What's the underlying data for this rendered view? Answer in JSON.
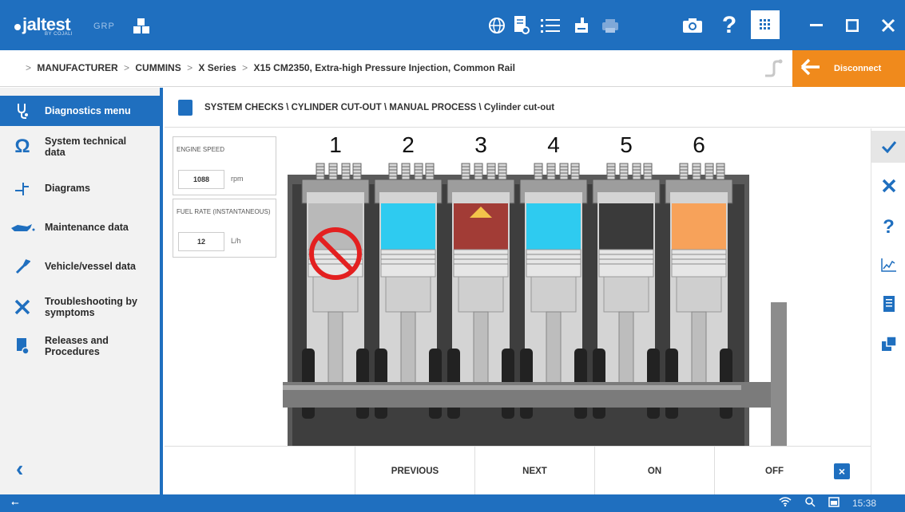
{
  "app": {
    "logo": "jaltest",
    "logo_sub": "BY COJALI",
    "grp": "GRP"
  },
  "toolbar": {
    "icons": [
      "globe-icon",
      "document-search-icon",
      "list-icon",
      "printer-icon",
      "printer-icon",
      "camera-icon",
      "help-icon",
      "apps-grid-icon"
    ],
    "window_controls": [
      "minimize-icon",
      "maximize-icon",
      "close-icon"
    ]
  },
  "breadcrumb": {
    "items": [
      "MANUFACTURER",
      "CUMMINS",
      "X Series",
      "X15 CM2350, Extra-high Pressure Injection, Common Rail"
    ],
    "separator": ">"
  },
  "disconnect": {
    "label": "Disconnect"
  },
  "sidebar": {
    "items": [
      {
        "label": "Diagnostics menu",
        "icon": "stethoscope-icon",
        "active": true
      },
      {
        "label": "System technical data",
        "icon": "omega-icon"
      },
      {
        "label": "Diagrams",
        "icon": "diagram-icon"
      },
      {
        "label": "Maintenance data",
        "icon": "oil-can-icon"
      },
      {
        "label": "Vehicle/vessel data",
        "icon": "wrench-icon"
      },
      {
        "label": "Troubleshooting by symptoms",
        "icon": "tools-icon"
      },
      {
        "label": "Releases and Procedures",
        "icon": "releases-icon"
      }
    ]
  },
  "main": {
    "header_title": "SYSTEM CHECKS \\ CYLINDER CUT-OUT \\ MANUAL PROCESS \\ Cylinder cut-out"
  },
  "params": [
    {
      "label": "ENGINE SPEED",
      "value": "1088",
      "unit": "rpm"
    },
    {
      "label": "FUEL RATE (INSTANTANEOUS)",
      "value": "12",
      "unit": "L/h"
    }
  ],
  "cylinders": [
    {
      "number": "1",
      "state": "cut-out",
      "color": "#b9b9b9"
    },
    {
      "number": "2",
      "state": "intake",
      "color": "#2ecbf0"
    },
    {
      "number": "3",
      "state": "combustion",
      "color": "#a23c36"
    },
    {
      "number": "4",
      "state": "intake",
      "color": "#2ecbf0"
    },
    {
      "number": "5",
      "state": "exhaust",
      "color": "#3a3a3a"
    },
    {
      "number": "6",
      "state": "compression",
      "color": "#f7a25a"
    }
  ],
  "bottom_buttons": [
    "PREVIOUS",
    "NEXT",
    "ON",
    "OFF"
  ],
  "right_bar": [
    "check-icon",
    "close-icon",
    "help-icon",
    "graph-icon",
    "list-icon",
    "clipboard-icon"
  ],
  "status": {
    "time": "15:38"
  },
  "colors": {
    "primary": "#1f6fbf",
    "accent": "#f08a1c"
  }
}
